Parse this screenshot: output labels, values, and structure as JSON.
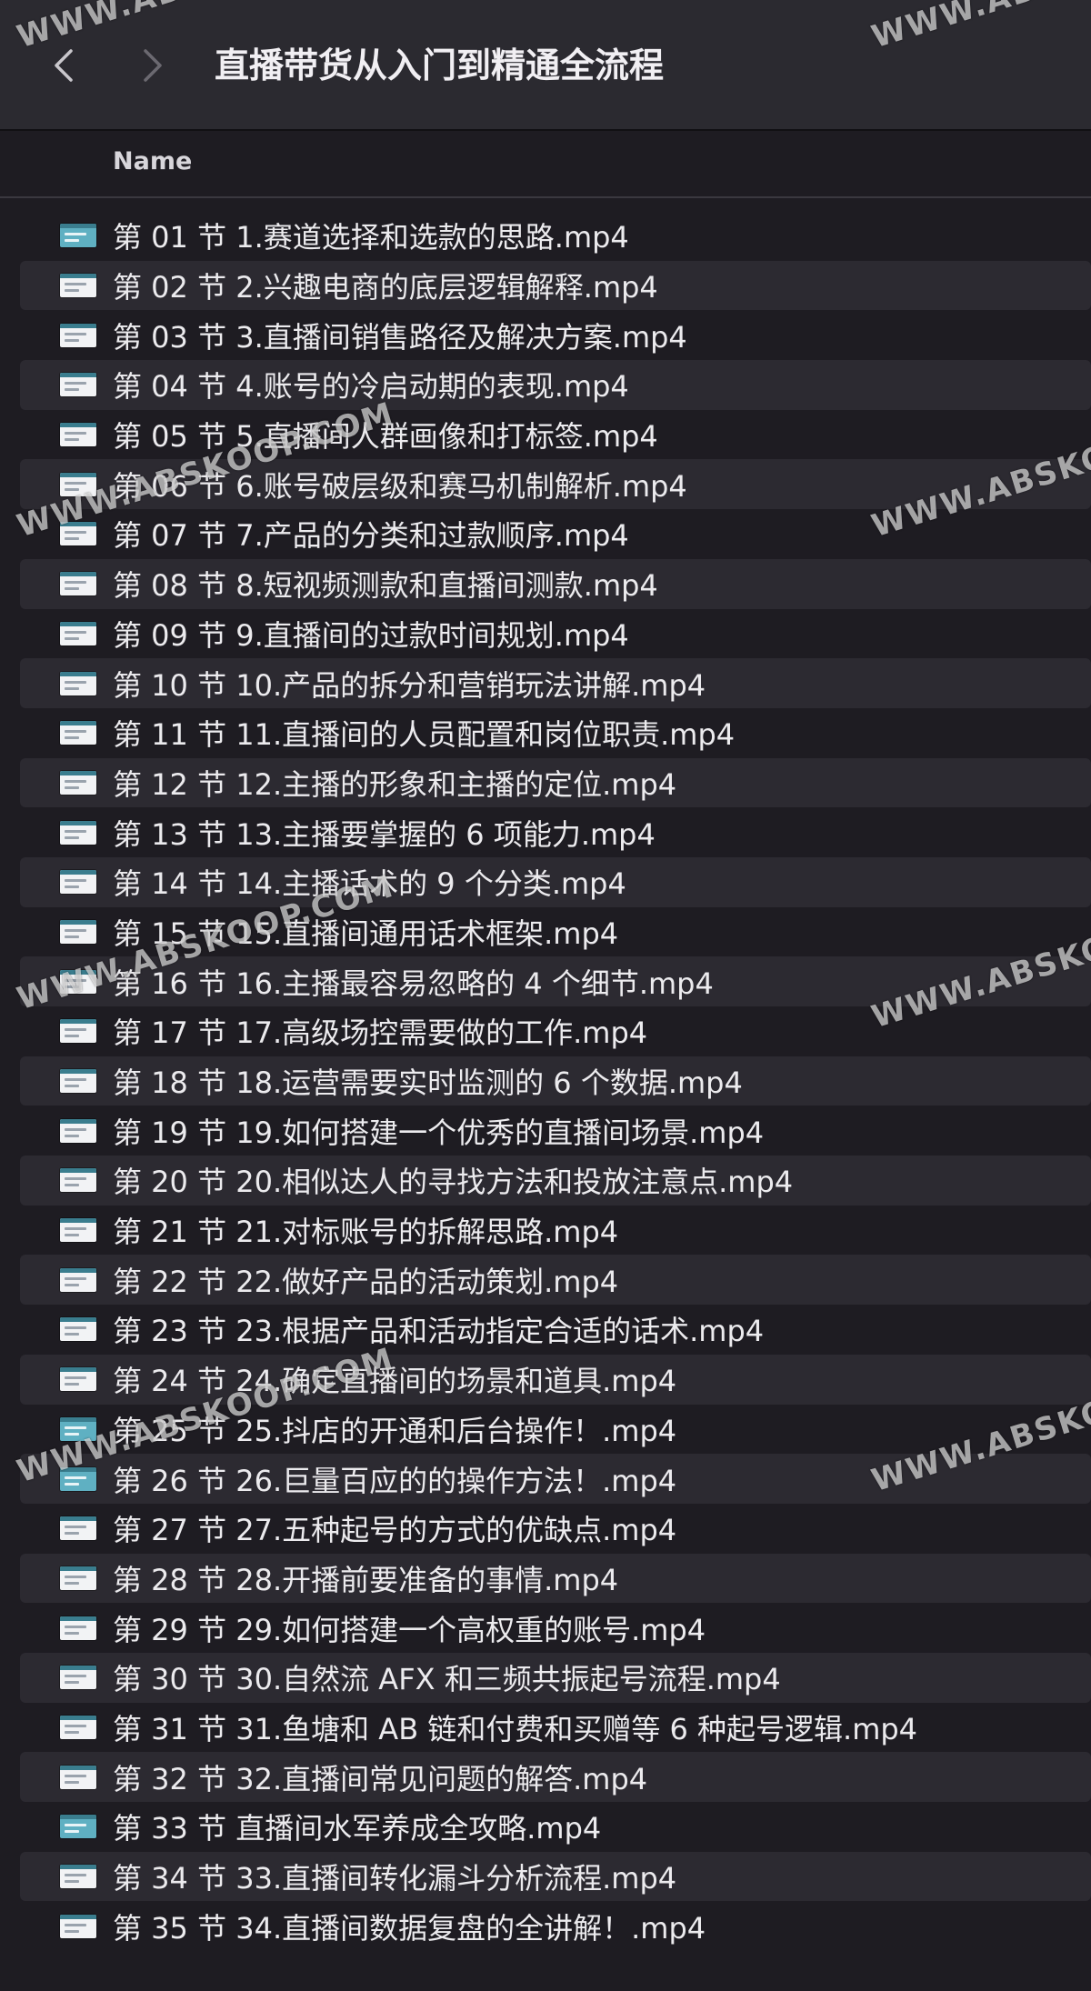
{
  "toolbar": {
    "title": "直播带货从入门到精通全流程",
    "back_icon": "chevron-left-icon",
    "forward_icon": "chevron-right-icon"
  },
  "columns": {
    "name": "Name"
  },
  "files": [
    {
      "name": "第 01 节 1.赛道选择和选款的思路.mp4",
      "thumb": "teal"
    },
    {
      "name": "第 02 节 2.兴趣电商的底层逻辑解释.mp4",
      "thumb": "doc"
    },
    {
      "name": "第 03 节 3.直播间销售路径及解决方案.mp4",
      "thumb": "doc"
    },
    {
      "name": "第 04 节 4.账号的冷启动期的表现.mp4",
      "thumb": "doc"
    },
    {
      "name": "第 05 节 5.直播间人群画像和打标签.mp4",
      "thumb": "doc"
    },
    {
      "name": "第 06 节 6.账号破层级和赛马机制解析.mp4",
      "thumb": "doc"
    },
    {
      "name": "第 07 节 7.产品的分类和过款顺序.mp4",
      "thumb": "doc"
    },
    {
      "name": "第 08 节 8.短视频测款和直播间测款.mp4",
      "thumb": "doc"
    },
    {
      "name": "第 09 节 9.直播间的过款时间规划.mp4",
      "thumb": "doc"
    },
    {
      "name": "第 10 节 10.产品的拆分和营销玩法讲解.mp4",
      "thumb": "doc"
    },
    {
      "name": "第 11 节 11.直播间的人员配置和岗位职责.mp4",
      "thumb": "doc"
    },
    {
      "name": "第 12 节 12.主播的形象和主播的定位.mp4",
      "thumb": "doc"
    },
    {
      "name": "第 13 节 13.主播要掌握的 6 项能力.mp4",
      "thumb": "doc"
    },
    {
      "name": "第 14 节 14.主播话术的 9 个分类.mp4",
      "thumb": "doc"
    },
    {
      "name": "第 15 节 15.直播间通用话术框架.mp4",
      "thumb": "doc"
    },
    {
      "name": "第 16 节 16.主播最容易忽略的 4 个细节.mp4",
      "thumb": "doc"
    },
    {
      "name": "第 17 节 17.高级场控需要做的工作.mp4",
      "thumb": "doc"
    },
    {
      "name": "第 18 节 18.运营需要实时监测的 6 个数据.mp4",
      "thumb": "doc"
    },
    {
      "name": "第 19 节 19.如何搭建一个优秀的直播间场景.mp4",
      "thumb": "doc"
    },
    {
      "name": "第 20 节 20.相似达人的寻找方法和投放注意点.mp4",
      "thumb": "doc"
    },
    {
      "name": "第 21 节 21.对标账号的拆解思路.mp4",
      "thumb": "doc"
    },
    {
      "name": "第 22 节 22.做好产品的活动策划.mp4",
      "thumb": "doc"
    },
    {
      "name": "第 23 节 23.根据产品和活动指定合适的话术.mp4",
      "thumb": "doc"
    },
    {
      "name": "第 24 节 24.确定直播间的场景和道具.mp4",
      "thumb": "doc"
    },
    {
      "name": "第 25 节 25.抖店的开通和后台操作！.mp4",
      "thumb": "teal"
    },
    {
      "name": "第 26 节 26.巨量百应的的操作方法！.mp4",
      "thumb": "teal"
    },
    {
      "name": "第 27 节 27.五种起号的方式的优缺点.mp4",
      "thumb": "doc"
    },
    {
      "name": "第 28 节 28.开播前要准备的事情.mp4",
      "thumb": "doc"
    },
    {
      "name": "第 29 节 29.如何搭建一个高权重的账号.mp4",
      "thumb": "doc"
    },
    {
      "name": "第 30 节 30.自然流 AFX 和三频共振起号流程.mp4",
      "thumb": "doc"
    },
    {
      "name": "第 31 节 31.鱼塘和 AB 链和付费和买赠等 6 种起号逻辑.mp4",
      "thumb": "doc"
    },
    {
      "name": "第 32 节 32.直播间常见问题的解答.mp4",
      "thumb": "doc"
    },
    {
      "name": "第 33 节 直播间水军养成全攻略.mp4",
      "thumb": "teal"
    },
    {
      "name": "第 34 节 33.直播间转化漏斗分析流程.mp4",
      "thumb": "doc"
    },
    {
      "name": "第 35 节 34.直播间数据复盘的全讲解！.mp4",
      "thumb": "doc"
    }
  ],
  "watermarks": [
    {
      "text": "WWW.ABSKOOP.COM"
    },
    {
      "text": "WWW.ABSKOOP.COM"
    },
    {
      "text": "WWW.ABSKOOP.COM"
    },
    {
      "text": "WWW.ABSKOOP.COM"
    },
    {
      "text": "WWW.ABSKOOP.COM"
    },
    {
      "text": "WWW.ABSKOOP.COM"
    },
    {
      "text": "WWW.ABSKOOP.COM"
    },
    {
      "text": "WWW.ABSKOOP.COM"
    }
  ]
}
